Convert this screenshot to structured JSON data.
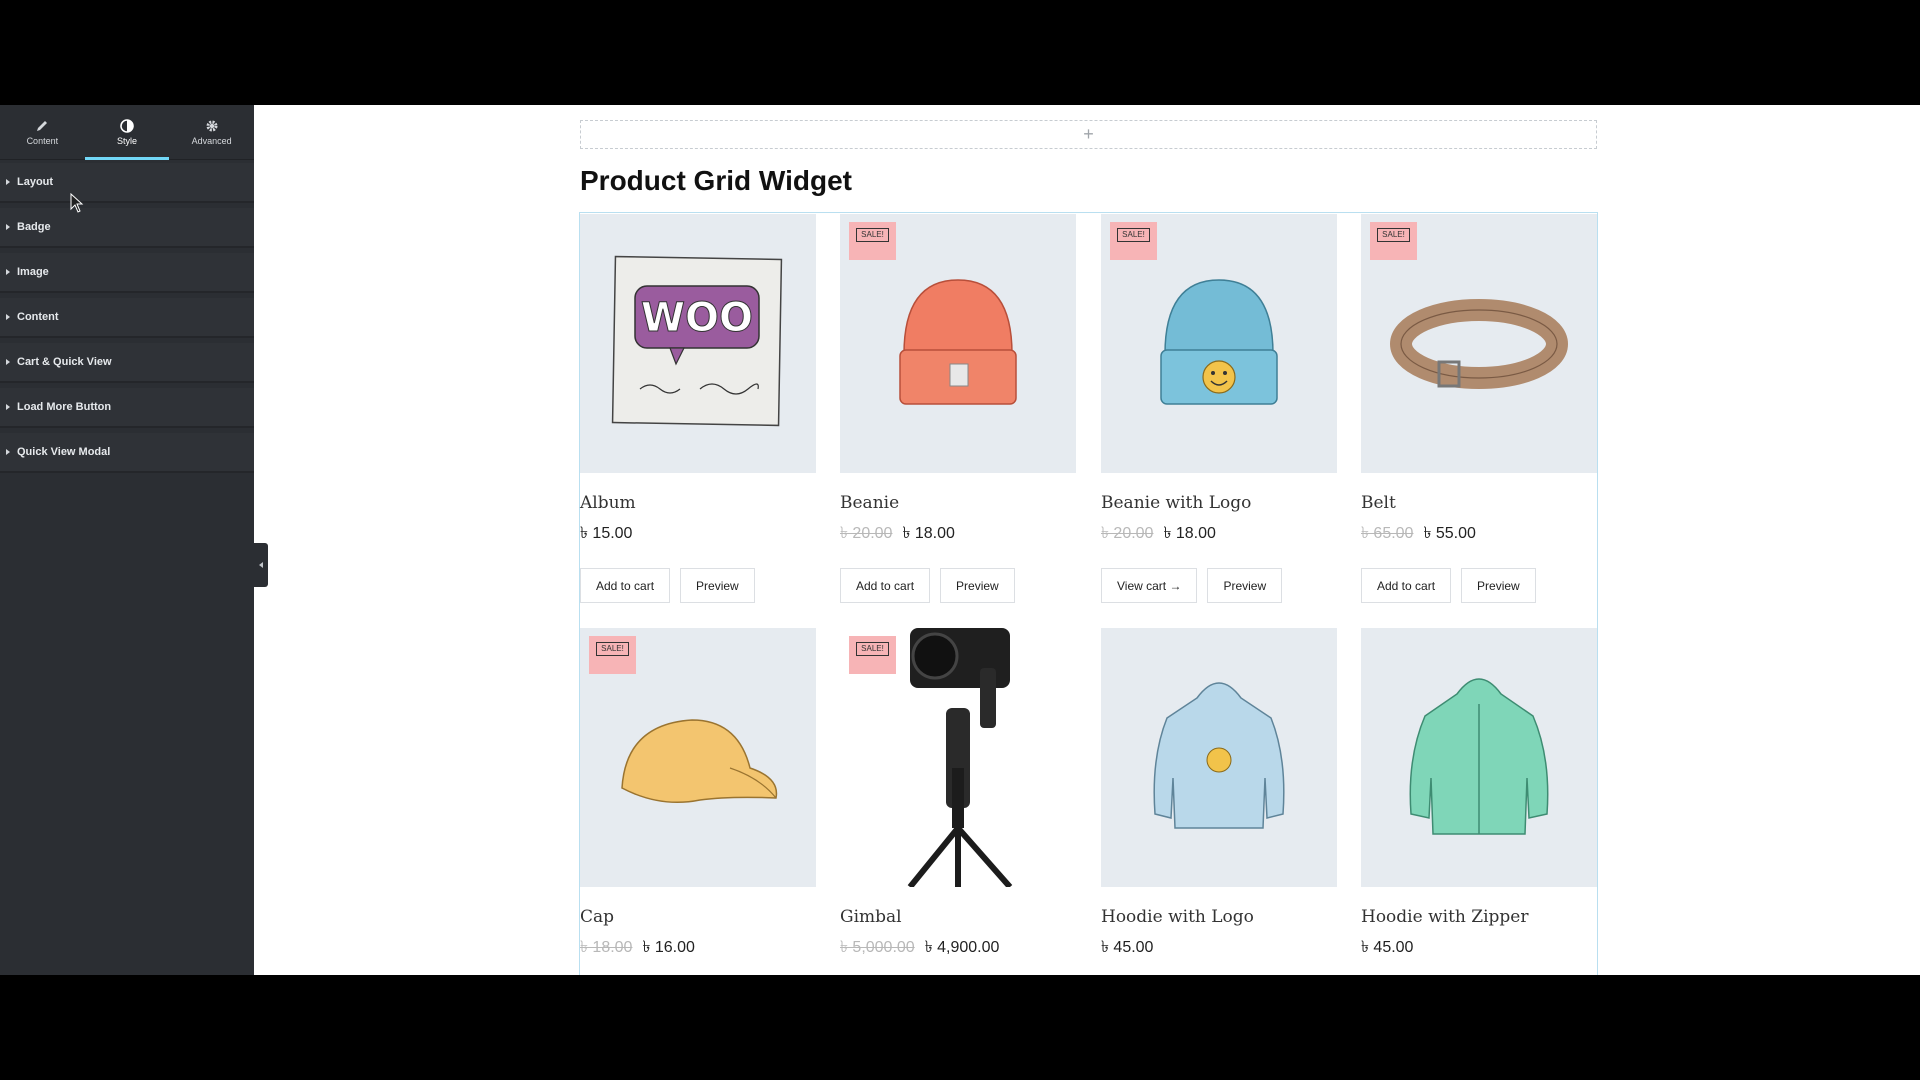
{
  "editor": {
    "tabs": [
      {
        "label": "Content",
        "icon": "pencil-icon",
        "active": false
      },
      {
        "label": "Style",
        "icon": "half-circle-icon",
        "active": true
      },
      {
        "label": "Advanced",
        "icon": "gear-icon",
        "active": false
      }
    ],
    "sections": [
      "Layout",
      "Badge",
      "Image",
      "Content",
      "Cart & Quick View",
      "Load More Button",
      "Quick View Modal"
    ],
    "accent_color": "#71d7f7"
  },
  "canvas": {
    "add_section_symbol": "+",
    "widget_title": "Product Grid Widget"
  },
  "currency": "৳",
  "products": [
    {
      "name": "Album",
      "sale": false,
      "old_price": "",
      "price": "৳ 15.00",
      "buttons": [
        "Add to cart",
        "Preview"
      ],
      "image": "album-image"
    },
    {
      "name": "Beanie",
      "sale": true,
      "badge": "SALE!",
      "old_price": "৳ 20.00",
      "price": "৳ 18.00",
      "buttons": [
        "Add to cart",
        "Preview"
      ],
      "image": "beanie-image"
    },
    {
      "name": "Beanie with Logo",
      "sale": true,
      "badge": "SALE!",
      "old_price": "৳ 20.00",
      "price": "৳ 18.00",
      "buttons": [
        "View cart →",
        "Preview"
      ],
      "image": "beanie-logo-image"
    },
    {
      "name": "Belt",
      "sale": true,
      "badge": "SALE!",
      "old_price": "৳ 65.00",
      "price": "৳ 55.00",
      "buttons": [
        "Add to cart",
        "Preview"
      ],
      "image": "belt-image"
    },
    {
      "name": "Cap",
      "sale": true,
      "badge": "SALE!",
      "old_price": "৳ 18.00",
      "price": "৳ 16.00",
      "buttons": [],
      "image": "cap-image"
    },
    {
      "name": "Gimbal",
      "sale": true,
      "badge": "SALE!",
      "old_price": "৳ 5,000.00",
      "price": "৳ 4,900.00",
      "buttons": [],
      "image": "gimbal-image"
    },
    {
      "name": "Hoodie with Logo",
      "sale": false,
      "old_price": "",
      "price": "৳ 45.00",
      "buttons": [],
      "image": "hoodie-logo-image"
    },
    {
      "name": "Hoodie with Zipper",
      "sale": false,
      "old_price": "",
      "price": "৳ 45.00",
      "buttons": [],
      "image": "hoodie-zipper-image"
    }
  ]
}
